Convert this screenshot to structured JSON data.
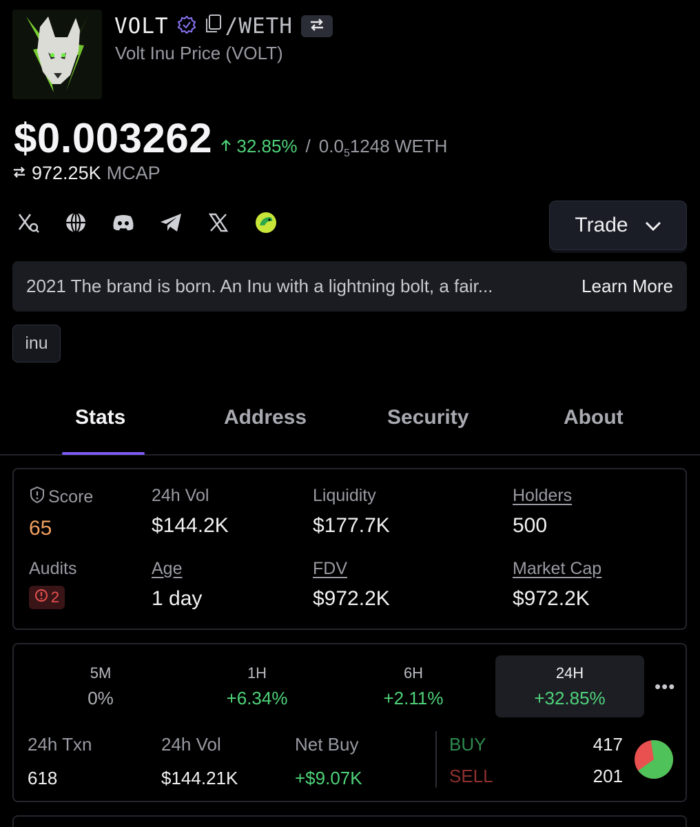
{
  "token": {
    "symbol": "VOLT",
    "pair_quote": "/WETH",
    "subtitle": "Volt Inu Price (VOLT)",
    "price": "$0.003262",
    "change": "32.85%",
    "slash": "/",
    "weth_main": "0.0",
    "weth_sub": "5",
    "weth_rest": "1248 WETH",
    "mcap_value": "972.25K",
    "mcap_label": "MCAP"
  },
  "socials": [
    "x-search-icon",
    "globe-icon",
    "discord-icon",
    "telegram-icon",
    "x-icon",
    "parrot-icon"
  ],
  "trade": {
    "label": "Trade"
  },
  "description": {
    "text": "2021 The brand is born. An Inu with a lightning bolt, a fair...",
    "learn_more": "Learn More"
  },
  "tags": [
    "inu"
  ],
  "tabs": [
    "Stats",
    "Address",
    "Security",
    "About"
  ],
  "stats": {
    "score_label": "Score",
    "score_value": "65",
    "vol_label": "24h Vol",
    "vol_value": "$144.2K",
    "liq_label": "Liquidity",
    "liq_value": "$177.7K",
    "holders_label": "Holders",
    "holders_value": "500",
    "audits_label": "Audits",
    "audits_count": "2",
    "age_label": "Age",
    "age_value": "1 day",
    "fdv_label": "FDV",
    "fdv_value": "$972.2K",
    "mcap_label": "Market Cap",
    "mcap_value": "$972.2K"
  },
  "timeframes": [
    {
      "name": "5M",
      "pct": "0%"
    },
    {
      "name": "1H",
      "pct": "+6.34%"
    },
    {
      "name": "6H",
      "pct": "+2.11%"
    },
    {
      "name": "24H",
      "pct": "+32.85%"
    }
  ],
  "txn": {
    "txn_label": "24h Txn",
    "txn_value": "618",
    "vol_label": "24h Vol",
    "vol_value": "$144.21K",
    "net_label": "Net Buy",
    "net_value": "+$9.07K",
    "buy_label": "BUY",
    "buy_value": "417",
    "sell_label": "SELL",
    "sell_value": "201",
    "buy_fraction": 0.675
  },
  "colors": {
    "accent": "#7c5cf5",
    "green": "#4fd37a",
    "red": "#e8514f",
    "orange": "#f0a060"
  }
}
